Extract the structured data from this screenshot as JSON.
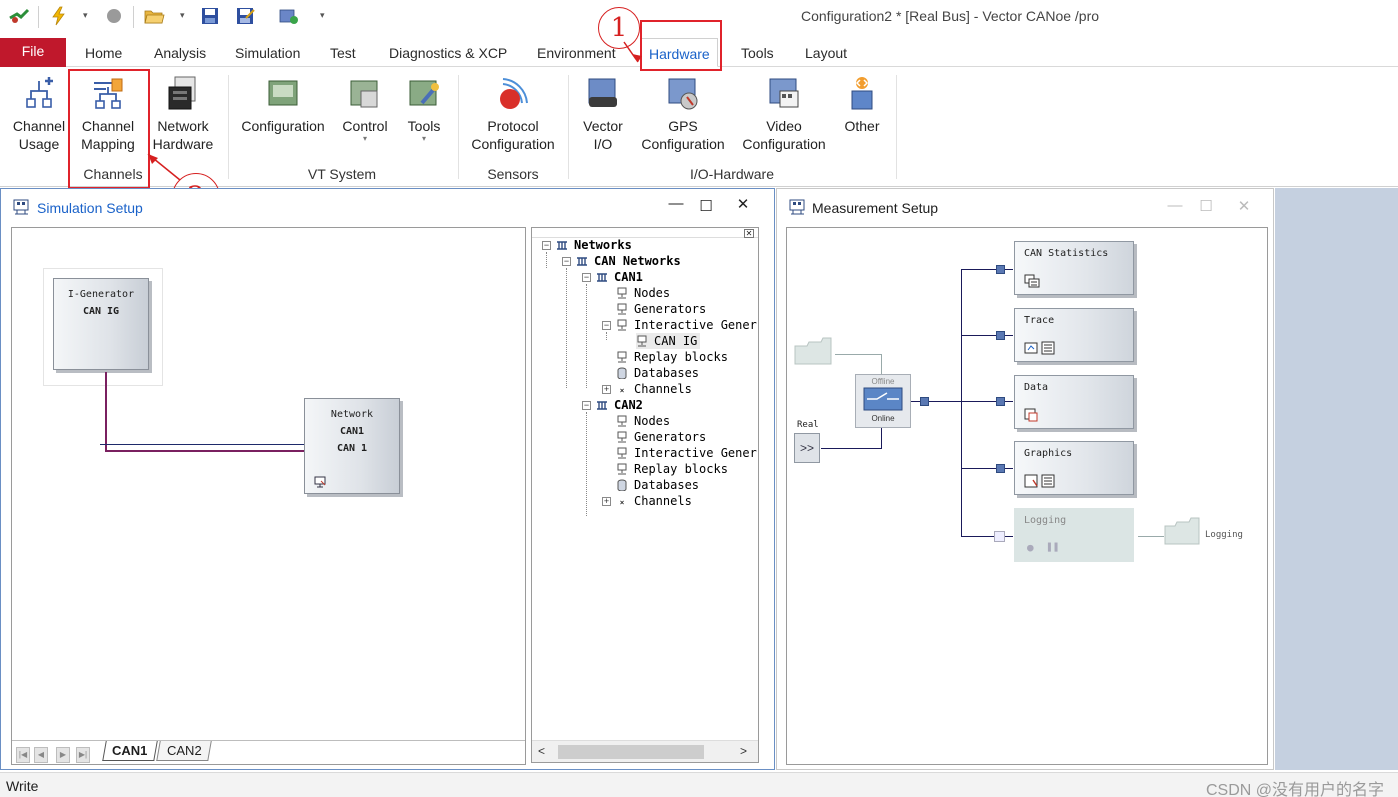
{
  "app": {
    "window_title": "Configuration2 * [Real Bus] - Vector CANoe /pro"
  },
  "quick_access": {
    "icons": [
      "canoe-logo-icon",
      "lightning-icon",
      "stop-icon",
      "open-folder-icon",
      "save-icon",
      "save-as-icon",
      "hardware-config-icon",
      "customize-icon"
    ]
  },
  "menu": {
    "file": "File",
    "tabs": [
      "Home",
      "Analysis",
      "Simulation",
      "Test",
      "Diagnostics & XCP",
      "Environment",
      "Hardware",
      "Tools",
      "Layout"
    ],
    "active_tab": "Hardware"
  },
  "ribbon": {
    "groups": [
      {
        "label": "Channels",
        "buttons": [
          {
            "line1": "Channel",
            "line2": "Usage",
            "icon": "channel-usage-icon"
          },
          {
            "line1": "Channel",
            "line2": "Mapping",
            "icon": "channel-mapping-icon"
          },
          {
            "line1": "Network",
            "line2": "Hardware",
            "icon": "network-hardware-icon"
          }
        ]
      },
      {
        "label": "VT System",
        "buttons": [
          {
            "line1": "Configuration",
            "line2": "",
            "icon": "vt-configuration-icon"
          },
          {
            "line1": "Control",
            "line2": "",
            "icon": "vt-control-icon"
          },
          {
            "line1": "Tools",
            "line2": "",
            "icon": "vt-tools-icon"
          }
        ]
      },
      {
        "label": "Sensors",
        "buttons": [
          {
            "line1": "Protocol",
            "line2": "Configuration",
            "icon": "protocol-configuration-icon"
          }
        ]
      },
      {
        "label": "I/O-Hardware",
        "buttons": [
          {
            "line1": "Vector",
            "line2": "I/O",
            "icon": "vector-io-icon"
          },
          {
            "line1": "GPS",
            "line2": "Configuration",
            "icon": "gps-configuration-icon"
          },
          {
            "line1": "Video",
            "line2": "Configuration",
            "icon": "video-configuration-icon"
          },
          {
            "line1": "Other",
            "line2": "",
            "icon": "other-io-icon"
          }
        ]
      }
    ]
  },
  "annotations": {
    "step1": "1",
    "step2": "2"
  },
  "simulation_setup": {
    "title": "Simulation Setup",
    "generator_block": {
      "title": "I-Generator",
      "subtitle": "CAN IG"
    },
    "network_block": {
      "title": "Network",
      "line1": "CAN1",
      "line2": "CAN 1"
    },
    "bottom_tabs": [
      "CAN1",
      "CAN2"
    ],
    "active_bottom_tab": "CAN1",
    "tree": {
      "root": "Networks",
      "can_networks": "CAN Networks",
      "can1": {
        "label": "CAN1",
        "children": [
          "Nodes",
          "Generators",
          "Interactive Gener",
          "Replay blocks",
          "Databases",
          "Channels"
        ],
        "ig_child": "CAN IG"
      },
      "can2": {
        "label": "CAN2",
        "children": [
          "Nodes",
          "Generators",
          "Interactive Gener",
          "Replay blocks",
          "Databases",
          "Channels"
        ]
      }
    }
  },
  "measurement_setup": {
    "title": "Measurement Setup",
    "offline_label": "Offline",
    "online_label": "Online",
    "real_label": "Real",
    "real_button": ">>",
    "blocks": [
      "CAN Statistics",
      "Trace",
      "Data",
      "Graphics",
      "Logging"
    ],
    "logging_output": "Logging"
  },
  "status": {
    "text": "Write",
    "watermark": "CSDN @没有用户的名字"
  }
}
